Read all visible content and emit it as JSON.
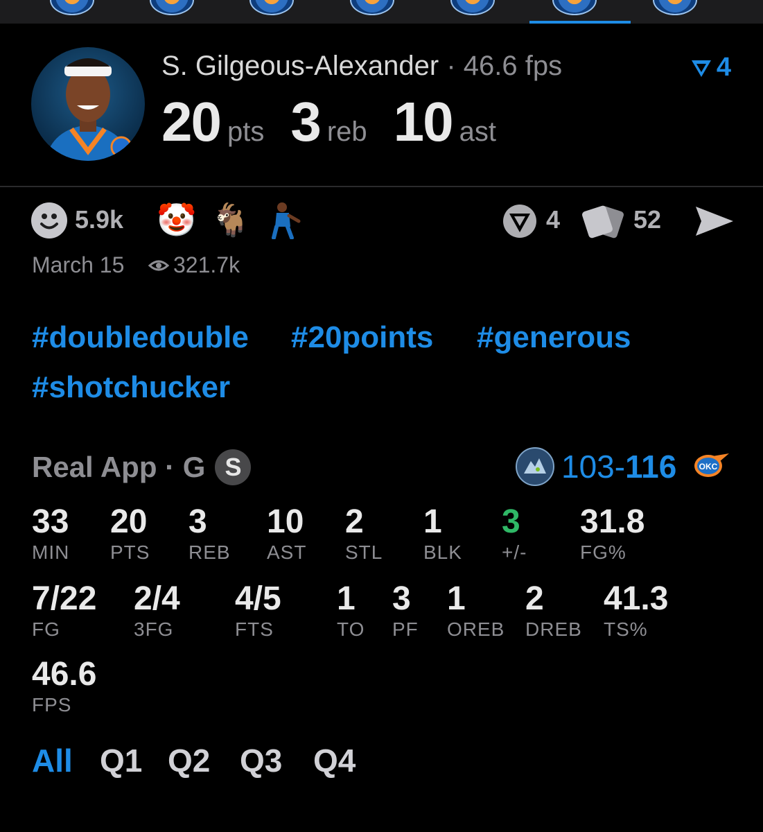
{
  "colors": {
    "accent": "#1e8ce6",
    "background": "#000000",
    "muted": "#8e8e93",
    "positive": "#2fb866"
  },
  "header": {
    "player_name": "S. Gilgeous-Alexander",
    "separator": "·",
    "fps_label": "46.6 fps",
    "rank_value": "4",
    "stats": [
      {
        "value": "20",
        "unit": "pts"
      },
      {
        "value": "3",
        "unit": "reb"
      },
      {
        "value": "10",
        "unit": "ast"
      }
    ]
  },
  "reactions": {
    "count": "5.9k",
    "icons": [
      "smiley-icon",
      "clown-face-icon",
      "goat-icon",
      "player-sticker-icon"
    ],
    "fire_count": "4",
    "cards_count": "52"
  },
  "meta": {
    "date": "March 15",
    "views": "321.7k"
  },
  "hashtags": [
    "#doubledouble",
    "#20points",
    "#generous",
    "#shotchucker"
  ],
  "game": {
    "source": "Real App · G",
    "badge": "S",
    "score_left": "103",
    "score_sep": "-",
    "score_right": "116"
  },
  "stats_grid": [
    {
      "value": "33",
      "label": "MIN"
    },
    {
      "value": "20",
      "label": "PTS"
    },
    {
      "value": "3",
      "label": "REB"
    },
    {
      "value": "10",
      "label": "AST"
    },
    {
      "value": "2",
      "label": "STL"
    },
    {
      "value": "1",
      "label": "BLK"
    },
    {
      "value": "3",
      "label": "+/-"
    },
    {
      "value": "31.8",
      "label": "FG%"
    },
    {
      "value": "7/22",
      "label": "FG"
    },
    {
      "value": "2/4",
      "label": "3FG"
    },
    {
      "value": "4/5",
      "label": "FTS"
    },
    {
      "value": "1",
      "label": "TO"
    },
    {
      "value": "3",
      "label": "PF"
    },
    {
      "value": "1",
      "label": "OREB"
    },
    {
      "value": "2",
      "label": "DREB"
    },
    {
      "value": "41.3",
      "label": "TS%"
    },
    {
      "value": "46.6",
      "label": "FPS"
    }
  ],
  "quarter_tabs": [
    "All",
    "Q1",
    "Q2",
    "Q3",
    "Q4"
  ]
}
